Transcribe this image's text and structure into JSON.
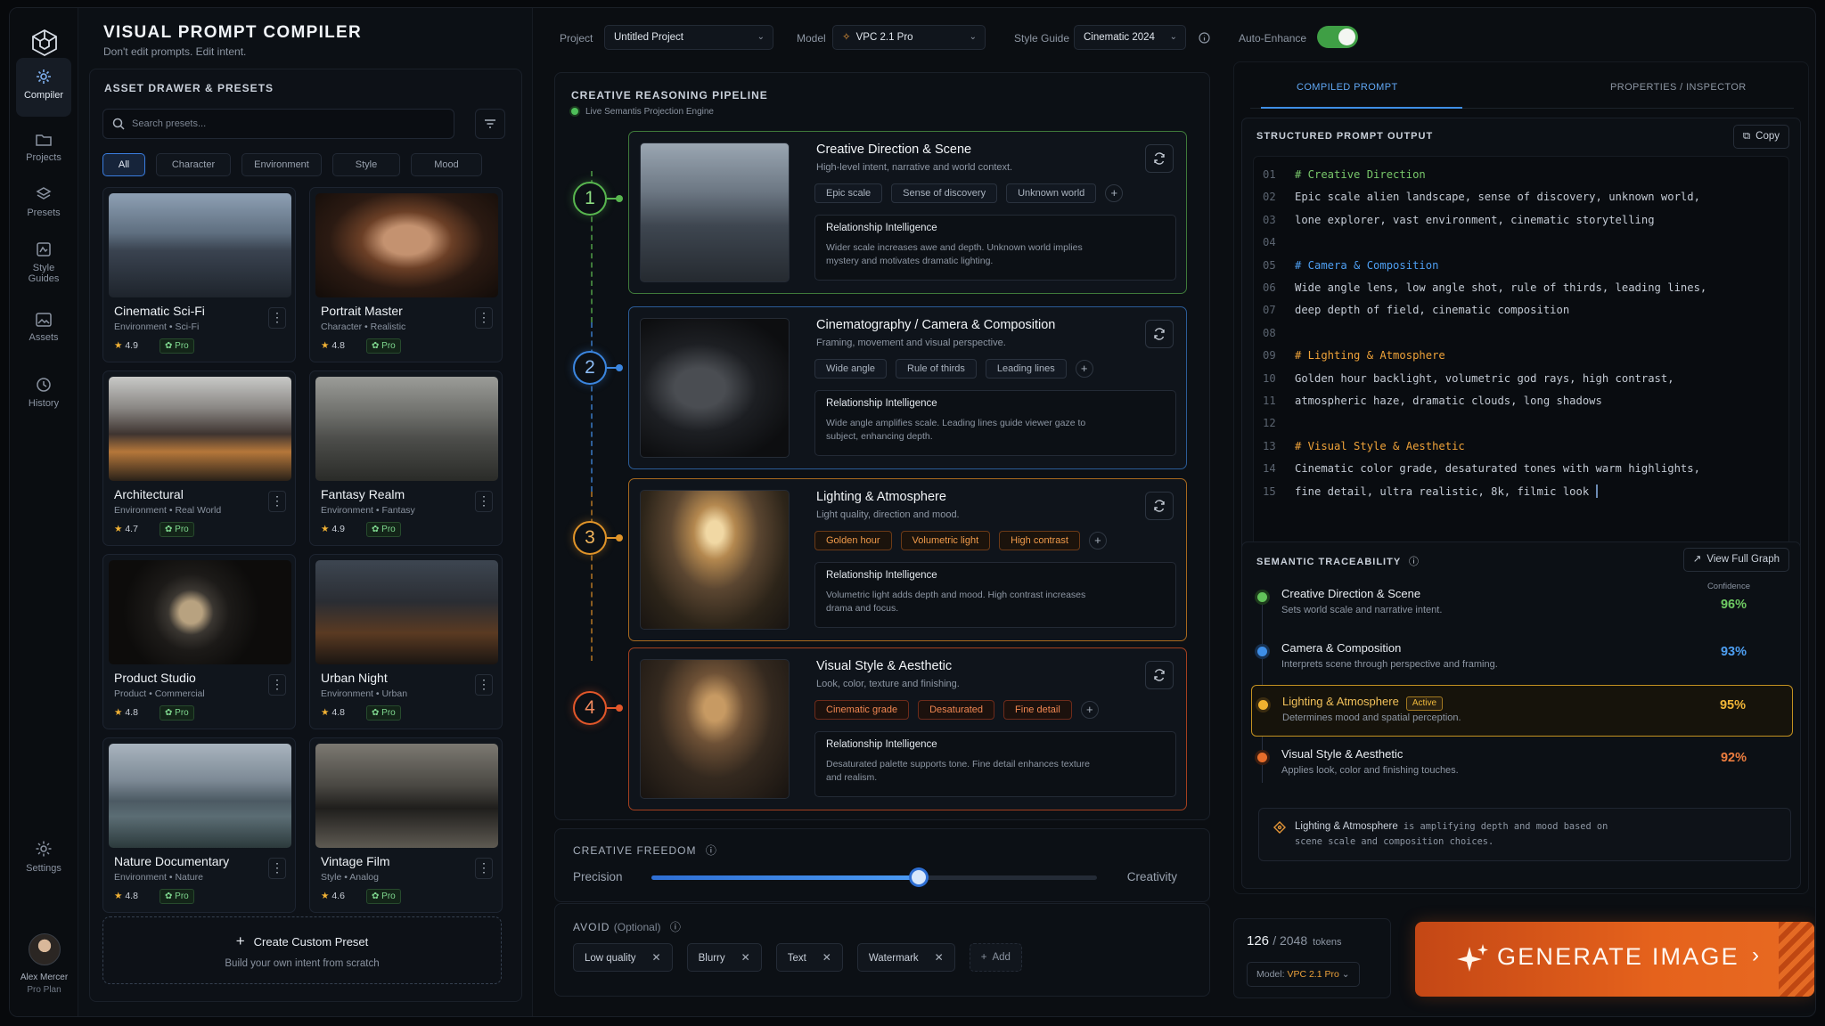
{
  "app": {
    "title": "VISUAL PROMPT COMPILER",
    "subtitle": "Don't edit prompts. Edit intent."
  },
  "rail": {
    "items": [
      {
        "label": "Compiler",
        "icon": "compiler-icon",
        "active": true
      },
      {
        "label": "Projects",
        "icon": "folder-icon"
      },
      {
        "label": "Presets",
        "icon": "layers-icon"
      },
      {
        "label": "Style Guides",
        "icon": "style-guide-icon"
      },
      {
        "label": "Assets",
        "icon": "image-icon"
      },
      {
        "label": "History",
        "icon": "history-icon"
      },
      {
        "label": "Settings",
        "icon": "gear-icon"
      }
    ],
    "user": {
      "name": "Alex Mercer",
      "plan": "Pro Plan"
    }
  },
  "drawer": {
    "title": "ASSET DRAWER & PRESETS",
    "search_placeholder": "Search presets...",
    "chips": [
      "All",
      "Character",
      "Environment",
      "Style",
      "Mood"
    ],
    "pro_label": "Pro",
    "presets": [
      {
        "name": "Cinematic Sci-Fi",
        "meta": "Environment  •  Sci-Fi",
        "rating": "4.9"
      },
      {
        "name": "Portrait Master",
        "meta": "Character  •  Realistic",
        "rating": "4.8"
      },
      {
        "name": "Architectural",
        "meta": "Environment  •  Real World",
        "rating": "4.7"
      },
      {
        "name": "Fantasy Realm",
        "meta": "Environment  •  Fantasy",
        "rating": "4.9"
      },
      {
        "name": "Product Studio",
        "meta": "Product  •  Commercial",
        "rating": "4.8"
      },
      {
        "name": "Urban Night",
        "meta": "Environment  •  Urban",
        "rating": "4.8"
      },
      {
        "name": "Nature Documentary",
        "meta": "Environment  •  Nature",
        "rating": "4.8"
      },
      {
        "name": "Vintage Film",
        "meta": "Style  •  Analog",
        "rating": "4.6"
      }
    ],
    "create": {
      "title": "Create Custom Preset",
      "subtitle": "Build your own intent from scratch"
    }
  },
  "topbar": {
    "project_label": "Project",
    "project_value": "Untitled Project",
    "model_label": "Model",
    "model_value": "VPC 2.1 Pro",
    "style_label": "Style Guide",
    "style_value": "Cinematic 2024",
    "auto_label": "Auto-Enhance",
    "auto_enabled": true
  },
  "pipeline": {
    "title": "CREATIVE REASONING PIPELINE",
    "subtitle": "Live Semantis Projection Engine",
    "ri_label": "Relationship Intelligence",
    "steps": [
      {
        "num": "1",
        "title": "Creative Direction & Scene",
        "desc": "High-level intent, narrative and world context.",
        "tags": [
          "Epic scale",
          "Sense of discovery",
          "Unknown world"
        ],
        "ri": "Wider scale increases awe and depth. Unknown world implies mystery and motivates dramatic lighting.",
        "color": "#58b64f"
      },
      {
        "num": "2",
        "title": "Cinematography / Camera & Composition",
        "desc": "Framing, movement and visual perspective.",
        "tags": [
          "Wide angle",
          "Rule of thirds",
          "Leading lines"
        ],
        "ri": "Wide angle amplifies scale. Leading lines guide viewer gaze to subject, enhancing depth.",
        "color": "#3b86e0"
      },
      {
        "num": "3",
        "title": "Lighting & Atmosphere",
        "desc": "Light quality, direction and mood.",
        "tags": [
          "Golden hour",
          "Volumetric light",
          "High contrast"
        ],
        "ri": "Volumetric light adds depth and mood. High contrast increases drama and focus.",
        "color": "#e09429"
      },
      {
        "num": "4",
        "title": "Visual Style & Aesthetic",
        "desc": "Look, color, texture and finishing.",
        "tags": [
          "Cinematic grade",
          "Desaturated",
          "Fine detail"
        ],
        "ri": "Desaturated palette supports tone. Fine detail enhances texture and realism.",
        "color": "#e2572a"
      }
    ]
  },
  "freedom": {
    "title": "CREATIVE FREEDOM",
    "left": "Precision",
    "right": "Creativity",
    "value": 0.6
  },
  "avoid": {
    "title": "AVOID",
    "optional": "(Optional)",
    "tags": [
      "Low quality",
      "Blurry",
      "Text",
      "Watermark"
    ],
    "add_label": "Add"
  },
  "right": {
    "tabs": [
      "COMPILED PROMPT",
      "PROPERTIES / INSPECTOR"
    ],
    "output_title": "STRUCTURED PROMPT OUTPUT",
    "copy_label": "Copy",
    "code": [
      {
        "n": "01",
        "t": "# Creative Direction",
        "c": "green"
      },
      {
        "n": "02",
        "t": "Epic scale alien landscape, sense of discovery, unknown world,",
        "c": ""
      },
      {
        "n": "03",
        "t": "lone explorer, vast environment, cinematic storytelling",
        "c": ""
      },
      {
        "n": "04",
        "t": "",
        "c": ""
      },
      {
        "n": "05",
        "t": "# Camera & Composition",
        "c": "blue"
      },
      {
        "n": "06",
        "t": "Wide angle lens, low angle shot, rule of thirds, leading lines,",
        "c": ""
      },
      {
        "n": "07",
        "t": "deep depth of field, cinematic composition",
        "c": ""
      },
      {
        "n": "08",
        "t": "",
        "c": ""
      },
      {
        "n": "09",
        "t": "# Lighting & Atmosphere",
        "c": "orange"
      },
      {
        "n": "10",
        "t": "Golden hour backlight, volumetric god rays, high contrast,",
        "c": ""
      },
      {
        "n": "11",
        "t": "atmospheric haze, dramatic clouds, long shadows",
        "c": ""
      },
      {
        "n": "12",
        "t": "",
        "c": ""
      },
      {
        "n": "13",
        "t": "# Visual Style & Aesthetic",
        "c": "orange"
      },
      {
        "n": "14",
        "t": "Cinematic color grade, desaturated tones with warm highlights,",
        "c": ""
      },
      {
        "n": "15",
        "t": "fine detail, ultra realistic, 8k, filmic look",
        "c": ""
      }
    ],
    "trace_title": "SEMANTIC TRACEABILITY",
    "graph_label": "View Full Graph",
    "confidence_label": "Confidence",
    "active_label": "Active",
    "trace": [
      {
        "name": "Creative Direction & Scene",
        "desc": "Sets world scale and narrative intent.",
        "conf": "96%",
        "color": "#62c25a"
      },
      {
        "name": "Camera & Composition",
        "desc": "Interprets scene through perspective and framing.",
        "conf": "93%",
        "color": "#3e8ee6"
      },
      {
        "name": "Lighting & Atmosphere",
        "desc": "Determines mood and spatial perception.",
        "conf": "95%",
        "color": "#efb12f"
      },
      {
        "name": "Visual Style & Aesthetic",
        "desc": "Applies look, color and finishing touches.",
        "conf": "92%",
        "color": "#e66d2b"
      }
    ],
    "note_highlight": "Lighting & Atmosphere",
    "note_line1": "is amplifying depth and mood based on",
    "note_line2": "scene scale and composition choices."
  },
  "footer": {
    "tokens_used": "126",
    "tokens_total": "2048",
    "tokens_unit": "tokens",
    "model_prefix": "Model:",
    "model_value": "VPC 2.1 Pro",
    "generate_label": "GENERATE IMAGE"
  }
}
